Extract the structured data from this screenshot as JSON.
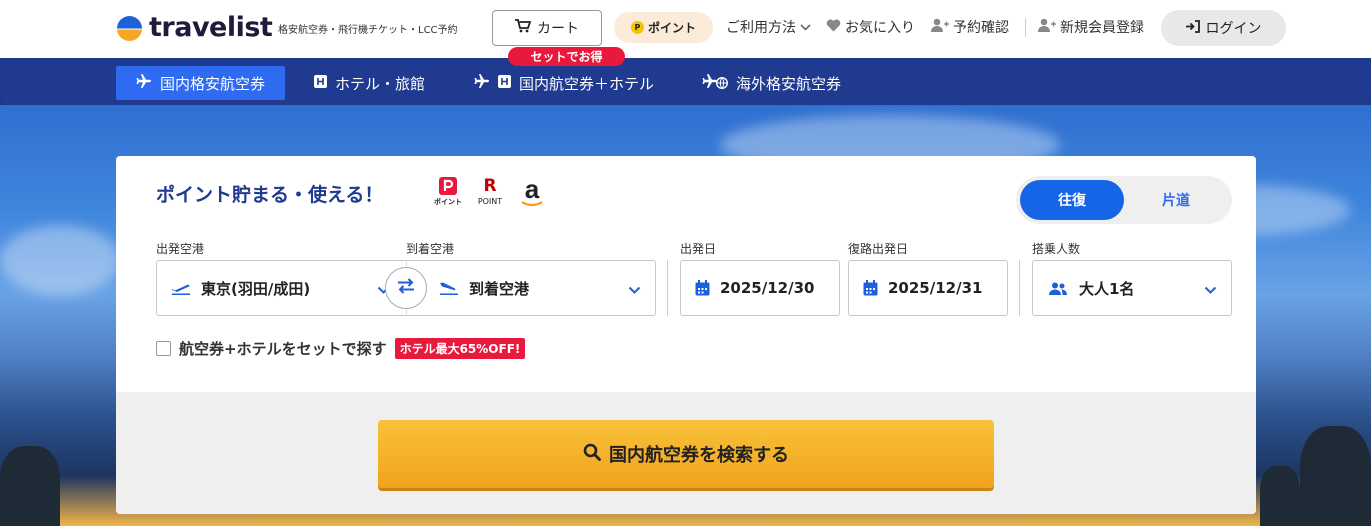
{
  "header": {
    "logo_text": "travelist",
    "tagline": "格安航空券・飛行機チケット・LCC予約",
    "cart_label": "カート",
    "points_label": "ポイント",
    "points_coin": "P",
    "nav": {
      "usage": "ご利用方法",
      "favorites": "お気に入り",
      "reservation": "予約確認",
      "register": "新規会員登録",
      "login": "ログイン"
    }
  },
  "tabs": {
    "domestic_flights": "国内格安航空券",
    "hotels": "ホテル・旅館",
    "flight_hotel": "国内航空券＋ホテル",
    "international": "海外格安航空券",
    "set_badge": "セットでお得"
  },
  "search": {
    "promo": "ポイント貯まる・使える！",
    "pay_logos": {
      "paypay_text": "ポイント",
      "rakuten_letter": "R",
      "rakuten_text": "POINT",
      "amazon_letter": "a"
    },
    "trip_type": {
      "round": "往復",
      "oneway": "片道"
    },
    "labels": {
      "departure_airport": "出発空港",
      "arrival_airport": "到着空港",
      "departure_date": "出発日",
      "return_date": "復路出発日",
      "passengers": "搭乗人数"
    },
    "values": {
      "departure_airport": "東京(羽田/成田)",
      "arrival_airport": "到着空港",
      "departure_date": "2025/12/30",
      "return_date": "2025/12/31",
      "passengers": "大人1名"
    },
    "hotel_set_label": "航空券+ホテルをセットで探す",
    "hotel_set_badge": "ホテル最大65%OFF!",
    "search_button": "国内航空券を検索する"
  },
  "colors": {
    "brand_navy": "#1f3a8f",
    "active_tab": "#2e6bf0",
    "accent_red": "#e8193c",
    "search_button": "#f5b02a"
  }
}
